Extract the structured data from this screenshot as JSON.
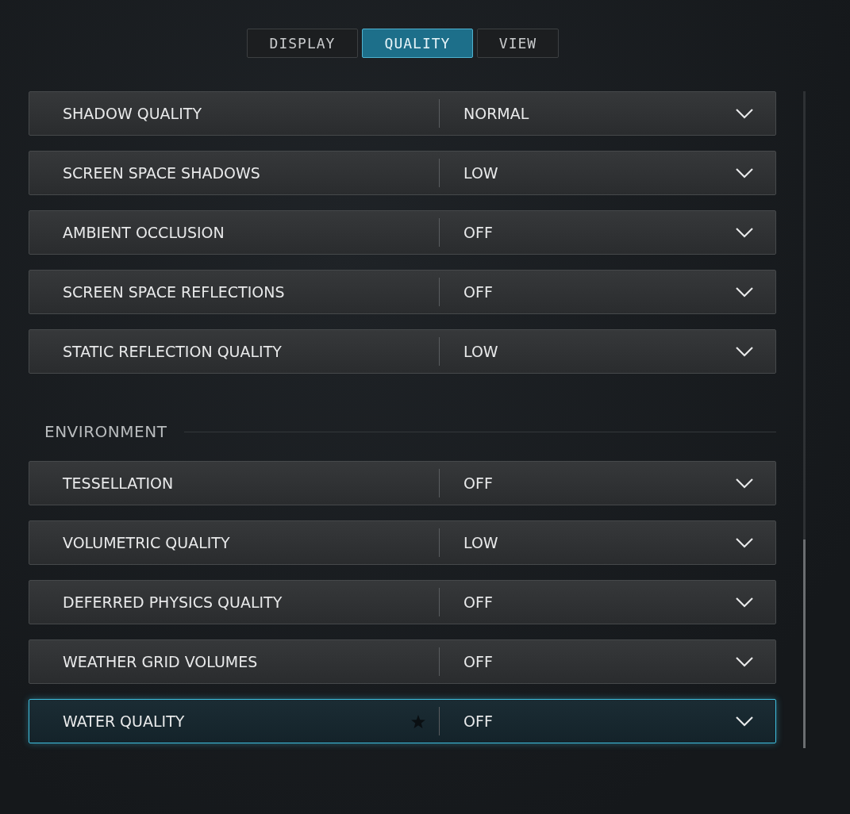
{
  "tabs": [
    {
      "label": "DISPLAY",
      "selected": false
    },
    {
      "label": "QUALITY",
      "selected": true
    },
    {
      "label": "VIEW",
      "selected": false
    }
  ],
  "sections": [
    {
      "rows": [
        {
          "label": "SHADOW QUALITY",
          "value": "NORMAL",
          "selected": false,
          "starred": false
        },
        {
          "label": "SCREEN SPACE SHADOWS",
          "value": "LOW",
          "selected": false,
          "starred": false
        },
        {
          "label": "AMBIENT OCCLUSION",
          "value": "OFF",
          "selected": false,
          "starred": false
        },
        {
          "label": "SCREEN SPACE REFLECTIONS",
          "value": "OFF",
          "selected": false,
          "starred": false
        },
        {
          "label": "STATIC REFLECTION QUALITY",
          "value": "LOW",
          "selected": false,
          "starred": false
        }
      ]
    },
    {
      "heading": "ENVIRONMENT",
      "rows": [
        {
          "label": "TESSELLATION",
          "value": "OFF",
          "selected": false,
          "starred": false
        },
        {
          "label": "VOLUMETRIC QUALITY",
          "value": "LOW",
          "selected": false,
          "starred": false
        },
        {
          "label": "DEFERRED PHYSICS QUALITY",
          "value": "OFF",
          "selected": false,
          "starred": false
        },
        {
          "label": "WEATHER GRID VOLUMES",
          "value": "OFF",
          "selected": false,
          "starred": false
        },
        {
          "label": "WATER QUALITY",
          "value": "OFF",
          "selected": true,
          "starred": true
        }
      ]
    }
  ]
}
